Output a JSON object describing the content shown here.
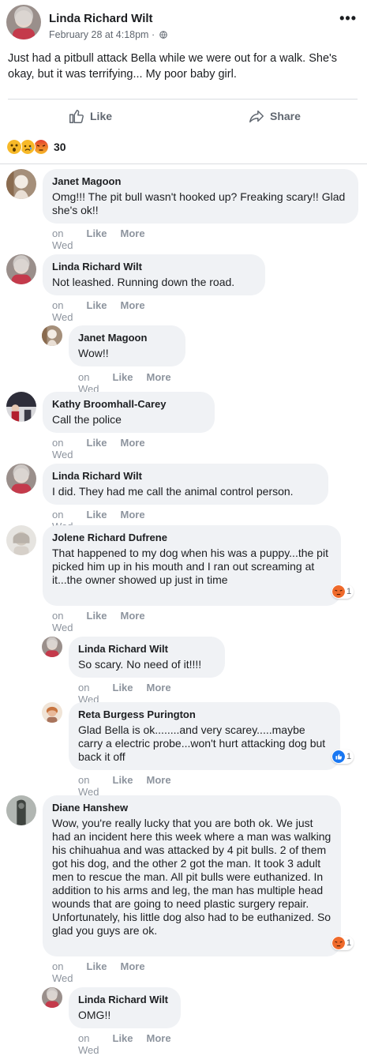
{
  "post": {
    "author": "Linda Richard Wilt",
    "timestamp": "February 28 at 4:18pm",
    "separator": "·",
    "privacy_icon": "globe-icon",
    "more_label": "•••",
    "text": "Just had a pitbull attack Bella while we were out for a walk. She's okay, but it was terrifying... My poor baby girl.",
    "actions": {
      "like": "Like",
      "share": "Share"
    },
    "reactions": {
      "icons": [
        "wow",
        "sad",
        "angry"
      ],
      "count": "30"
    }
  },
  "comments": [
    {
      "name": "Janet Magoon",
      "text": "Omg!!! The pit bull wasn't hooked up? Freaking scary!! Glad she's ok!!",
      "time": "on Wed",
      "like": "Like",
      "more": "More"
    },
    {
      "name": "Linda Richard Wilt",
      "text": "Not leashed. Running down the road.",
      "time": "on Wed",
      "like": "Like",
      "more": "More"
    },
    {
      "name": "Janet Magoon",
      "text": "Wow!!",
      "time": "on Wed",
      "like": "Like",
      "more": "More"
    },
    {
      "name": "Kathy Broomhall-Carey",
      "text": "Call the police",
      "time": "on Wed",
      "like": "Like",
      "more": "More"
    },
    {
      "name": "Linda Richard Wilt",
      "text": "I did. They had me call the animal control person.",
      "time": "on Wed",
      "like": "Like",
      "more": "More"
    },
    {
      "name": "Jolene Richard Dufrene",
      "text": "That happened to my dog when his was a puppy...the pit picked him up in his mouth and I ran out screaming at it...the owner showed up just in time",
      "time": "on Wed",
      "like": "Like",
      "more": "More",
      "reaction": "angry",
      "reaction_count": "1"
    },
    {
      "name": "Linda Richard Wilt",
      "text": "So scary. No need of it!!!!",
      "time": "on Wed",
      "like": "Like",
      "more": "More"
    },
    {
      "name": "Reta Burgess Purington",
      "text": "Glad Bella is ok........and very scarey.....maybe carry a electric probe...won't hurt attacking dog but back it off",
      "time": "on Wed",
      "like": "Like",
      "more": "More",
      "reaction": "like",
      "reaction_count": "1"
    },
    {
      "name": "Diane Hanshew",
      "text": "Wow, you're really lucky that you are both ok. We just had an incident here this week where a man was walking his chihuahua and was attacked by 4 pit bulls. 2 of them got his dog, and the other 2 got the man. It took 3 adult men to rescue the man. All pit bulls were euthanized. In addition to his arms and leg, the man has multiple head wounds that are going to need plastic surgery repair. Unfortunately, his little dog also had to be euthanized. So glad you guys are ok.",
      "time": "on Wed",
      "like": "Like",
      "more": "More",
      "reaction": "angry",
      "reaction_count": "1"
    },
    {
      "name": "Linda Richard Wilt",
      "text": "OMG!!",
      "time": "on Wed",
      "like": "Like",
      "more": "More"
    }
  ],
  "colors": {
    "bubble": "#f0f2f5",
    "meta": "#606770",
    "like_blue": "#1877f2",
    "angry": "#e9710f",
    "wow": "#f7b928"
  }
}
